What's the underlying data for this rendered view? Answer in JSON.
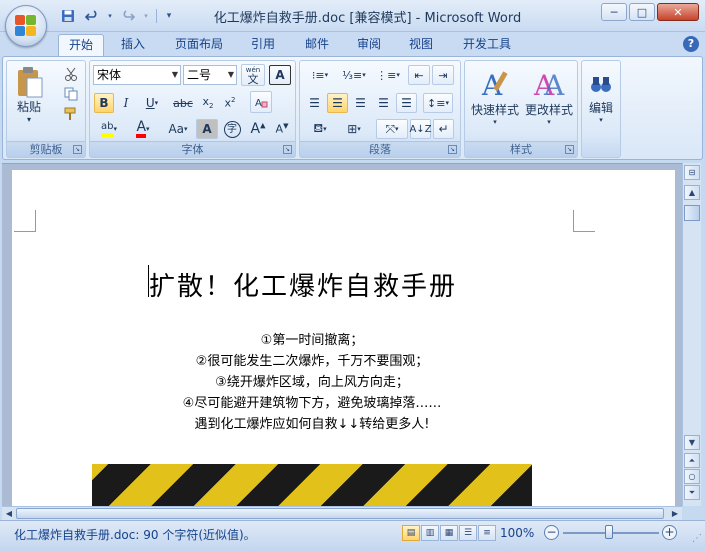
{
  "window": {
    "title": "化工爆炸自救手册.doc [兼容模式] - Microsoft Word",
    "minimize": "─",
    "maximize": "□",
    "close": "✕"
  },
  "qat": {
    "save_icon": "floppy-disk-icon",
    "undo_icon": "undo-icon",
    "redo_icon": "redo-icon",
    "customize_icon": "customize-icon"
  },
  "tabs": [
    {
      "label": "开始",
      "active": true
    },
    {
      "label": "插入"
    },
    {
      "label": "页面布局"
    },
    {
      "label": "引用"
    },
    {
      "label": "邮件"
    },
    {
      "label": "审阅"
    },
    {
      "label": "视图"
    },
    {
      "label": "开发工具"
    }
  ],
  "help": "?",
  "ribbon": {
    "clipboard": {
      "label": "剪贴板",
      "paste": "粘贴"
    },
    "font": {
      "label": "字体",
      "font_name": "宋体",
      "font_size": "二号",
      "wen": "wén\n文",
      "a_box": "A",
      "aa": "Aa",
      "a_shade": "A",
      "circle": "字"
    },
    "paragraph": {
      "label": "段落"
    },
    "styles": {
      "label": "样式",
      "quick_styles": "快速样式",
      "change_styles": "更改样式"
    },
    "editing": {
      "label": "编辑"
    }
  },
  "document": {
    "title": "扩散！化工爆炸自救手册",
    "lines": [
      "①第一时间撤离；",
      "②很可能发生二次爆炸，千万不要围观；",
      "③绕开爆炸区域，向上风方向走；",
      "④尽可能避开建筑物下方，避免玻璃掉落……",
      "遇到化工爆炸应如何自救↓↓转给更多人!"
    ]
  },
  "status": {
    "text": "化工爆炸自救手册.doc: 90 个字符(近似值)。",
    "zoom": "100%",
    "zoom_minus": "−",
    "zoom_plus": "+"
  },
  "colors": {
    "highlight": "#ffff00",
    "font_color": "#ff0000",
    "accent": "#15428b"
  }
}
